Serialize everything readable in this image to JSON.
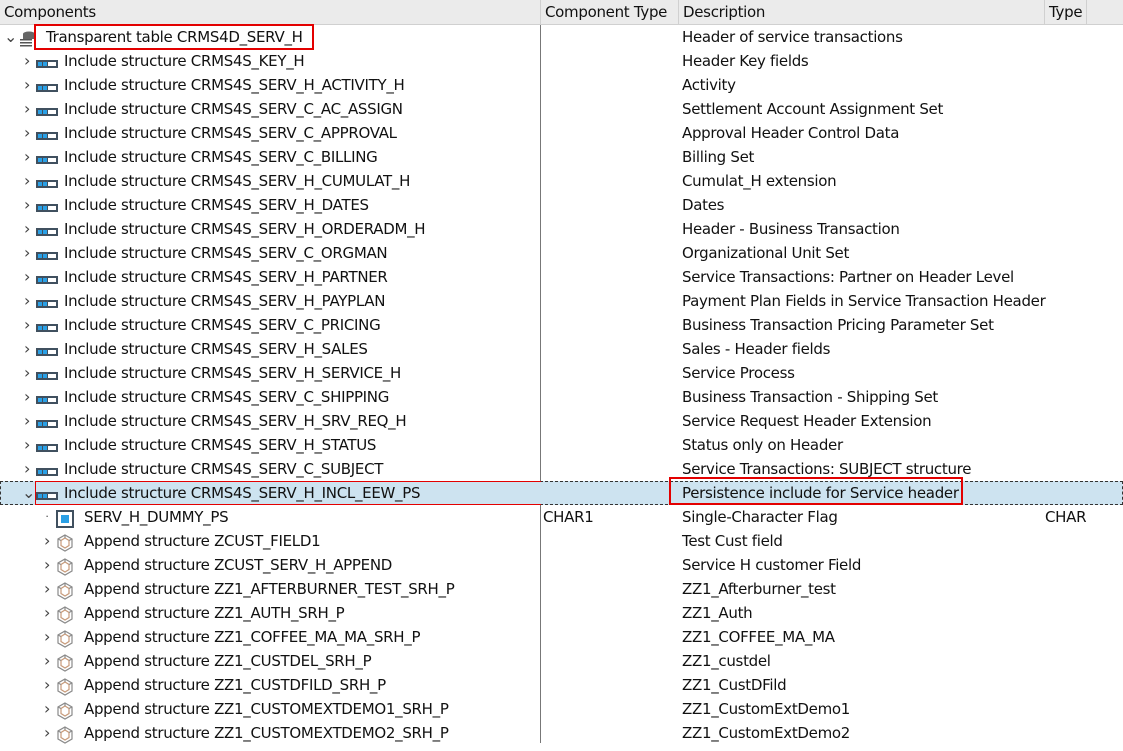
{
  "columns": [
    "Components",
    "Component Type",
    "Description",
    "Type"
  ],
  "rows": [
    {
      "level": 0,
      "toggle": "expanded",
      "icon": "database-table-icon",
      "name": "Transparent table CRMS4D_SERV_H",
      "ctype": "",
      "desc": "Header of service transactions",
      "type": "",
      "highlight": true
    },
    {
      "level": 1,
      "toggle": "collapsed",
      "icon": "structure-icon",
      "name": "Include structure CRMS4S_KEY_H",
      "ctype": "",
      "desc": "Header Key fields",
      "type": ""
    },
    {
      "level": 1,
      "toggle": "collapsed",
      "icon": "structure-icon",
      "name": "Include structure CRMS4S_SERV_H_ACTIVITY_H",
      "ctype": "",
      "desc": "Activity",
      "type": ""
    },
    {
      "level": 1,
      "toggle": "collapsed",
      "icon": "structure-icon",
      "name": "Include structure CRMS4S_SERV_C_AC_ASSIGN",
      "ctype": "",
      "desc": "Settlement Account Assignment Set",
      "type": ""
    },
    {
      "level": 1,
      "toggle": "collapsed",
      "icon": "structure-icon",
      "name": "Include structure CRMS4S_SERV_C_APPROVAL",
      "ctype": "",
      "desc": "Approval Header Control Data",
      "type": ""
    },
    {
      "level": 1,
      "toggle": "collapsed",
      "icon": "structure-icon",
      "name": "Include structure CRMS4S_SERV_C_BILLING",
      "ctype": "",
      "desc": "Billing Set",
      "type": ""
    },
    {
      "level": 1,
      "toggle": "collapsed",
      "icon": "structure-icon",
      "name": "Include structure CRMS4S_SERV_H_CUMULAT_H",
      "ctype": "",
      "desc": "Cumulat_H extension",
      "type": ""
    },
    {
      "level": 1,
      "toggle": "collapsed",
      "icon": "structure-icon",
      "name": "Include structure CRMS4S_SERV_H_DATES",
      "ctype": "",
      "desc": "Dates",
      "type": ""
    },
    {
      "level": 1,
      "toggle": "collapsed",
      "icon": "structure-icon",
      "name": "Include structure CRMS4S_SERV_H_ORDERADM_H",
      "ctype": "",
      "desc": "Header - Business Transaction",
      "type": ""
    },
    {
      "level": 1,
      "toggle": "collapsed",
      "icon": "structure-icon",
      "name": "Include structure CRMS4S_SERV_C_ORGMAN",
      "ctype": "",
      "desc": "Organizational Unit Set",
      "type": ""
    },
    {
      "level": 1,
      "toggle": "collapsed",
      "icon": "structure-icon",
      "name": "Include structure CRMS4S_SERV_H_PARTNER",
      "ctype": "",
      "desc": "Service Transactions: Partner on Header Level",
      "type": ""
    },
    {
      "level": 1,
      "toggle": "collapsed",
      "icon": "structure-icon",
      "name": "Include structure CRMS4S_SERV_H_PAYPLAN",
      "ctype": "",
      "desc": "Payment Plan Fields in Service Transaction Header",
      "type": ""
    },
    {
      "level": 1,
      "toggle": "collapsed",
      "icon": "structure-icon",
      "name": "Include structure CRMS4S_SERV_C_PRICING",
      "ctype": "",
      "desc": "Business Transaction Pricing Parameter Set",
      "type": ""
    },
    {
      "level": 1,
      "toggle": "collapsed",
      "icon": "structure-icon",
      "name": "Include structure CRMS4S_SERV_H_SALES",
      "ctype": "",
      "desc": "Sales - Header fields",
      "type": ""
    },
    {
      "level": 1,
      "toggle": "collapsed",
      "icon": "structure-icon",
      "name": "Include structure CRMS4S_SERV_H_SERVICE_H",
      "ctype": "",
      "desc": "Service Process",
      "type": ""
    },
    {
      "level": 1,
      "toggle": "collapsed",
      "icon": "structure-icon",
      "name": "Include structure CRMS4S_SERV_C_SHIPPING",
      "ctype": "",
      "desc": "Business Transaction - Shipping Set",
      "type": ""
    },
    {
      "level": 1,
      "toggle": "collapsed",
      "icon": "structure-icon",
      "name": "Include structure CRMS4S_SERV_H_SRV_REQ_H",
      "ctype": "",
      "desc": "Service Request Header Extension",
      "type": ""
    },
    {
      "level": 1,
      "toggle": "collapsed",
      "icon": "structure-icon",
      "name": "Include structure CRMS4S_SERV_H_STATUS",
      "ctype": "",
      "desc": "Status only on Header",
      "type": ""
    },
    {
      "level": 1,
      "toggle": "collapsed",
      "icon": "structure-icon",
      "name": "Include structure CRMS4S_SERV_C_SUBJECT",
      "ctype": "",
      "desc": "Service Transactions: SUBJECT structure",
      "type": ""
    },
    {
      "level": 1,
      "toggle": "expanded",
      "icon": "structure-icon",
      "name": "Include structure CRMS4S_SERV_H_INCL_EEW_PS",
      "ctype": "",
      "desc": "Persistence include for Service header",
      "type": "",
      "selected": true,
      "highlight_desc": true
    },
    {
      "level": 2,
      "toggle": "leaf",
      "icon": "field-icon",
      "name": "SERV_H_DUMMY_PS",
      "ctype": "CHAR1",
      "desc": "Single-Character Flag",
      "type": "CHAR"
    },
    {
      "level": 2,
      "toggle": "collapsed",
      "icon": "append-structure-icon",
      "name": "Append structure ZCUST_FIELD1",
      "ctype": "",
      "desc": "Test Cust field",
      "type": ""
    },
    {
      "level": 2,
      "toggle": "collapsed",
      "icon": "append-structure-icon",
      "name": "Append structure ZCUST_SERV_H_APPEND",
      "ctype": "",
      "desc": "Service H customer Field",
      "type": ""
    },
    {
      "level": 2,
      "toggle": "collapsed",
      "icon": "append-structure-icon",
      "name": "Append structure ZZ1_AFTERBURNER_TEST_SRH_P",
      "ctype": "",
      "desc": "ZZ1_Afterburner_test",
      "type": ""
    },
    {
      "level": 2,
      "toggle": "collapsed",
      "icon": "append-structure-icon",
      "name": "Append structure ZZ1_AUTH_SRH_P",
      "ctype": "",
      "desc": "ZZ1_Auth",
      "type": ""
    },
    {
      "level": 2,
      "toggle": "collapsed",
      "icon": "append-structure-icon",
      "name": "Append structure ZZ1_COFFEE_MA_MA_SRH_P",
      "ctype": "",
      "desc": "ZZ1_COFFEE_MA_MA",
      "type": ""
    },
    {
      "level": 2,
      "toggle": "collapsed",
      "icon": "append-structure-icon",
      "name": "Append structure ZZ1_CUSTDEL_SRH_P",
      "ctype": "",
      "desc": "ZZ1_custdel",
      "type": ""
    },
    {
      "level": 2,
      "toggle": "collapsed",
      "icon": "append-structure-icon",
      "name": "Append structure ZZ1_CUSTDFILD_SRH_P",
      "ctype": "",
      "desc": "ZZ1_CustDFild",
      "type": ""
    },
    {
      "level": 2,
      "toggle": "collapsed",
      "icon": "append-structure-icon",
      "name": "Append structure ZZ1_CUSTOMEXTDEMO1_SRH_P",
      "ctype": "",
      "desc": "ZZ1_CustomExtDemo1",
      "type": ""
    },
    {
      "level": 2,
      "toggle": "collapsed",
      "icon": "append-structure-icon",
      "name": "Append structure ZZ1_CUSTOMEXTDEMO2_SRH_P",
      "ctype": "",
      "desc": "ZZ1_CustomExtDemo2",
      "type": ""
    }
  ]
}
